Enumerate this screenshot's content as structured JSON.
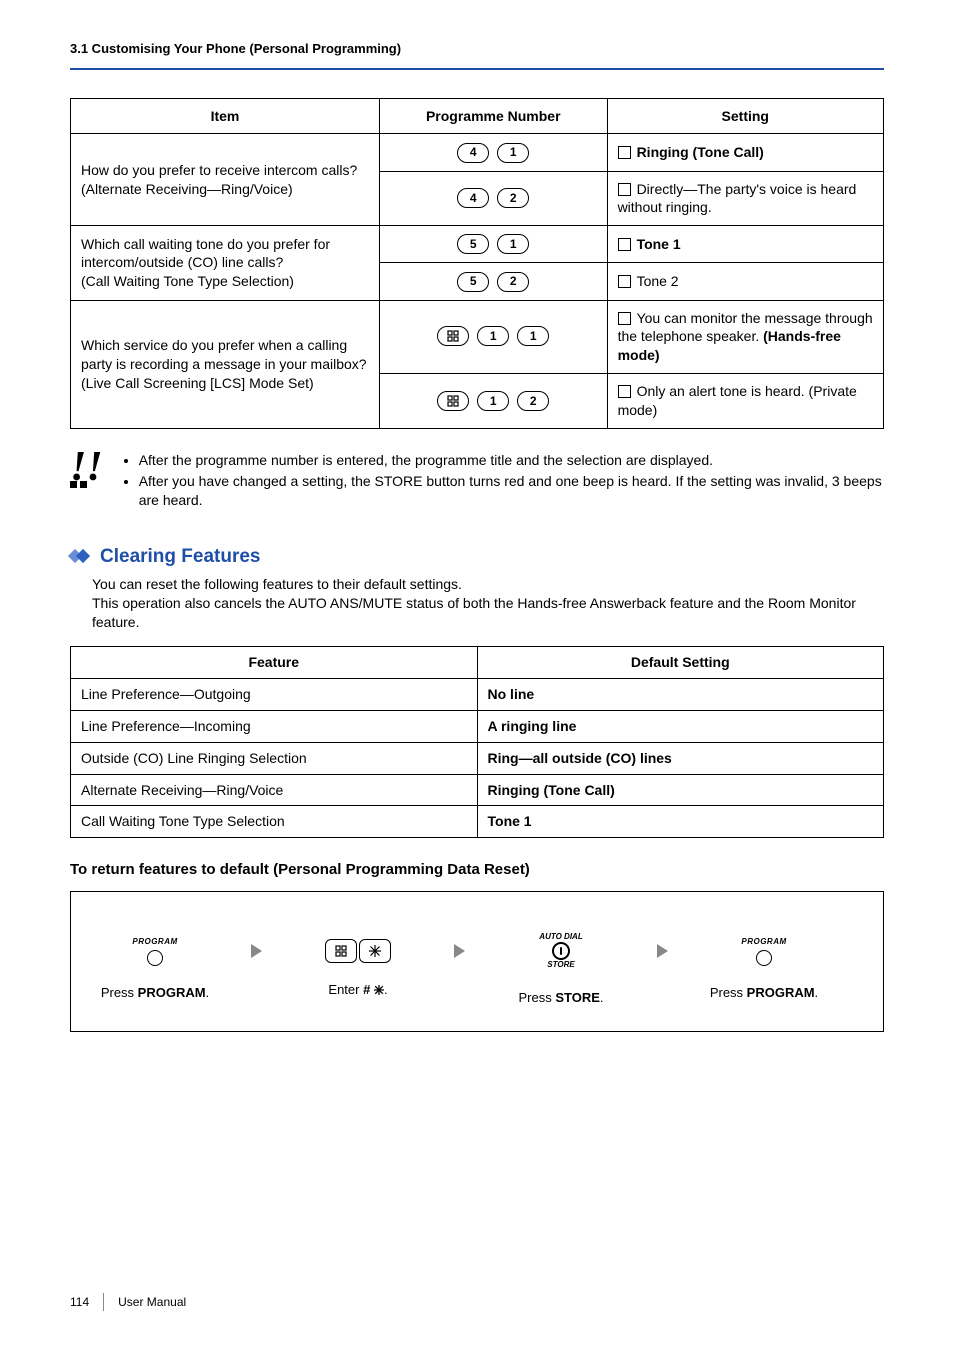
{
  "header": {
    "section": "3.1 Customising Your Phone (Personal Programming)"
  },
  "table1": {
    "headers": {
      "item": "Item",
      "prog": "Programme Number",
      "set": "Setting"
    },
    "rows": [
      {
        "item": "How do you prefer to receive intercom calls?\n(Alternate Receiving—Ring/Voice)",
        "sub": [
          {
            "keys": [
              "4",
              "1"
            ],
            "setting_bold": "Ringing (Tone Call)",
            "setting_rest": ""
          },
          {
            "keys": [
              "4",
              "2"
            ],
            "setting_bold": "",
            "setting_rest": "Directly—The party's voice is heard without ringing."
          }
        ]
      },
      {
        "item": "Which call waiting tone do you prefer for intercom/outside (CO) line calls?\n(Call Waiting Tone Type Selection)",
        "sub": [
          {
            "keys": [
              "5",
              "1"
            ],
            "setting_bold": "Tone 1",
            "setting_rest": ""
          },
          {
            "keys": [
              "5",
              "2"
            ],
            "setting_bold": "",
            "setting_rest": "Tone 2"
          }
        ]
      },
      {
        "item": "Which service do you prefer when a calling party is recording a message in your mailbox?\n(Live Call Screening [LCS] Mode Set)",
        "sub": [
          {
            "keys": [
              "#",
              "1",
              "1"
            ],
            "setting_prefix": "You can monitor the message through the telephone speaker. ",
            "setting_bold": "(Hands-free mode)",
            "hash_first": true
          },
          {
            "keys": [
              "#",
              "1",
              "2"
            ],
            "setting_prefix": "",
            "setting_rest": "Only an alert tone is heard. (Private mode)",
            "hash_first": true
          }
        ]
      }
    ]
  },
  "notes": [
    "After the programme number is entered, the programme title and the selection are displayed.",
    "After you have changed a setting, the STORE button turns red and one beep is heard. If the setting was invalid, 3 beeps are heard."
  ],
  "clearing": {
    "title": "Clearing Features",
    "body": "You can reset the following features to their default settings.\nThis operation also cancels the AUTO ANS/MUTE status of both the Hands-free Answerback feature and the Room Monitor feature."
  },
  "table2": {
    "headers": {
      "feature": "Feature",
      "default": "Default Setting"
    },
    "rows": [
      {
        "feature": "Line Preference—Outgoing",
        "default": "No line"
      },
      {
        "feature": "Line Preference—Incoming",
        "default": "A ringing line"
      },
      {
        "feature": "Outside (CO) Line Ringing Selection",
        "default": "Ring—all outside (CO) lines"
      },
      {
        "feature": "Alternate Receiving—Ring/Voice",
        "default": "Ringing (Tone Call)"
      },
      {
        "feature": "Call Waiting Tone Type Selection",
        "default": "Tone 1"
      }
    ]
  },
  "subheading": "To return features to default (Personal Programming Data Reset)",
  "procedure": {
    "steps": [
      {
        "icon": "program",
        "caption_pre": "Press ",
        "caption_bold": "PROGRAM",
        "caption_post": "."
      },
      {
        "icon": "hashstar",
        "caption_pre": "Enter ",
        "caption_bold": "#",
        "caption_star": true,
        "caption_post": "."
      },
      {
        "icon": "store",
        "caption_pre": "Press ",
        "caption_bold": "STORE",
        "caption_post": "."
      },
      {
        "icon": "program",
        "caption_pre": "Press ",
        "caption_bold": "PROGRAM",
        "caption_post": "."
      }
    ],
    "program_label": "PROGRAM",
    "auto_dial": "AUTO DIAL",
    "store_label": "STORE"
  },
  "footer": {
    "page": "114",
    "label": "User Manual"
  }
}
